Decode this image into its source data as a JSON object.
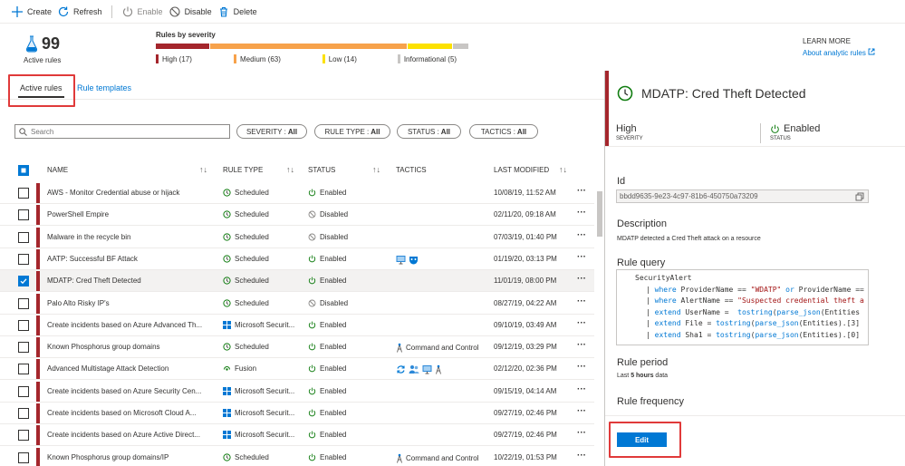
{
  "toolbar": {
    "create": "Create",
    "refresh": "Refresh",
    "enable": "Enable",
    "disable": "Disable",
    "delete": "Delete"
  },
  "summary": {
    "count": "99",
    "count_label": "Active rules",
    "severity_title": "Rules by severity",
    "severity": [
      {
        "label": "High (17)",
        "count": 17,
        "color": "#a4262c"
      },
      {
        "label": "Medium (63)",
        "count": 63,
        "color": "#f7a24b"
      },
      {
        "label": "Low (14)",
        "count": 14,
        "color": "#fce100"
      },
      {
        "label": "Informational (5)",
        "count": 5,
        "color": "#c8c6c4"
      }
    ],
    "learn_more": "LEARN MORE",
    "learn_link": "About analytic rules"
  },
  "tabs": {
    "active": "Active rules",
    "templates": "Rule templates"
  },
  "filters": {
    "search_placeholder": "Search",
    "severity": {
      "label": "SEVERITY :",
      "value": "All"
    },
    "rule_type": {
      "label": "RULE TYPE :",
      "value": "All"
    },
    "status": {
      "label": "STATUS :",
      "value": "All"
    },
    "tactics": {
      "label": "TACTICS :",
      "value": "All"
    }
  },
  "columns": {
    "name": "NAME",
    "rule_type": "RULE TYPE",
    "status": "STATUS",
    "tactics": "TACTICS",
    "last_modified": "LAST MODIFIED"
  },
  "rows": [
    {
      "name": "AWS - Monitor Credential abuse or hijack",
      "type": "Scheduled",
      "status": "Enabled",
      "tactics_text": "",
      "tactic_icons": [],
      "date": "10/08/19, 11:52 AM"
    },
    {
      "name": "PowerShell Empire",
      "type": "Scheduled",
      "status": "Disabled",
      "tactics_text": "",
      "tactic_icons": [],
      "date": "02/11/20, 09:18 AM"
    },
    {
      "name": "Malware in the recycle bin",
      "type": "Scheduled",
      "status": "Disabled",
      "tactics_text": "",
      "tactic_icons": [],
      "date": "07/03/19, 01:40 PM"
    },
    {
      "name": "AATP: Successful BF Attack",
      "type": "Scheduled",
      "status": "Enabled",
      "tactics_text": "",
      "tactic_icons": [
        "monitor-icon",
        "mask-icon"
      ],
      "date": "01/19/20, 03:13 PM"
    },
    {
      "name": "MDATP: Cred Theft Detected",
      "type": "Scheduled",
      "status": "Enabled",
      "tactics_text": "",
      "tactic_icons": [],
      "date": "11/01/19, 08:00 PM"
    },
    {
      "name": "Palo Alto Risky IP's",
      "type": "Scheduled",
      "status": "Disabled",
      "tactics_text": "",
      "tactic_icons": [],
      "date": "08/27/19, 04:22 AM"
    },
    {
      "name": "Create incidents based on Azure Advanced Th...",
      "type": "Microsoft Securit...",
      "status": "Enabled",
      "tactics_text": "",
      "tactic_icons": [],
      "date": "09/10/19, 03:49 AM"
    },
    {
      "name": "Known Phosphorus group domains",
      "type": "Scheduled",
      "status": "Enabled",
      "tactics_text": "Command and Control",
      "tactic_icons": [
        "tower-icon"
      ],
      "date": "09/12/19, 03:29 PM"
    },
    {
      "name": "Advanced Multistage Attack Detection",
      "type": "Fusion",
      "status": "Enabled",
      "tactics_text": "",
      "tactic_icons": [
        "cycle-icon",
        "people-icon",
        "monitor-icon",
        "tower-icon"
      ],
      "date": "02/12/20, 02:36 PM"
    },
    {
      "name": "Create incidents based on Azure Security Cen...",
      "type": "Microsoft Securit...",
      "status": "Enabled",
      "tactics_text": "",
      "tactic_icons": [],
      "date": "09/15/19, 04:14 AM"
    },
    {
      "name": "Create incidents based on Microsoft Cloud A...",
      "type": "Microsoft Securit...",
      "status": "Enabled",
      "tactics_text": "",
      "tactic_icons": [],
      "date": "09/27/19, 02:46 PM"
    },
    {
      "name": "Create incidents based on Azure Active Direct...",
      "type": "Microsoft Securit...",
      "status": "Enabled",
      "tactics_text": "",
      "tactic_icons": [],
      "date": "09/27/19, 02:46 PM"
    },
    {
      "name": "Known Phosphorus group domains/IP",
      "type": "Scheduled",
      "status": "Enabled",
      "tactics_text": "Command and Control",
      "tactic_icons": [
        "tower-icon"
      ],
      "date": "10/22/19, 01:53 PM"
    }
  ],
  "detail": {
    "title": "MDATP: Cred Theft Detected",
    "severity": "High",
    "severity_label": "SEVERITY",
    "status": "Enabled",
    "status_label": "STATUS",
    "id_label": "Id",
    "id": "bbdd9635-9e23-4c97-81b6-450750a73209",
    "description_label": "Description",
    "description": "MDATP detected a Cred Theft attack on a resource",
    "query_label": "Rule query",
    "query_lines": [
      "SecurityAlert",
      "| where ProviderName == \"WDATP\" or ProviderName ==",
      "| where AlertName == \"Suspected credential theft a",
      "| extend UserName =  tostring(parse_json(Entities",
      "| extend File = tostring(parse_json(Entities).[3]",
      "| extend Sha1 = tostring(parse_json(Entities).[0]"
    ],
    "period_label": "Rule period",
    "period_prefix": "Last ",
    "period_value": "5 hours",
    "period_suffix": " data",
    "frequency_label": "Rule frequency",
    "edit": "Edit"
  },
  "colors": {
    "accent": "#0078d4",
    "high": "#a4262c",
    "enabled": "#107c10",
    "highlight": "#e03a3a"
  }
}
